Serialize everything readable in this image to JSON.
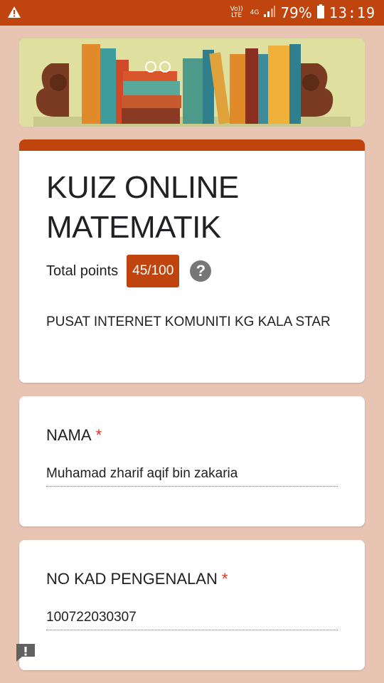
{
  "status_bar": {
    "volte": "Vo))",
    "lte": "LTE",
    "network": "4G",
    "battery_percent": "79%",
    "time": "13:19"
  },
  "form": {
    "title": "KUIZ ONLINE MATEMATIK",
    "total_points_label": "Total points",
    "score": "45/100",
    "description": "PUSAT INTERNET KOMUNITI KG KALA STAR"
  },
  "questions": [
    {
      "label": "NAMA",
      "required_mark": "*",
      "answer": "Muhamad zharif aqif bin zakaria"
    },
    {
      "label": "NO KAD PENGENALAN",
      "required_mark": "*",
      "answer": "100722030307"
    }
  ],
  "colors": {
    "accent": "#c0440d",
    "page_background": "#e8c4b2",
    "required": "#d93025"
  }
}
